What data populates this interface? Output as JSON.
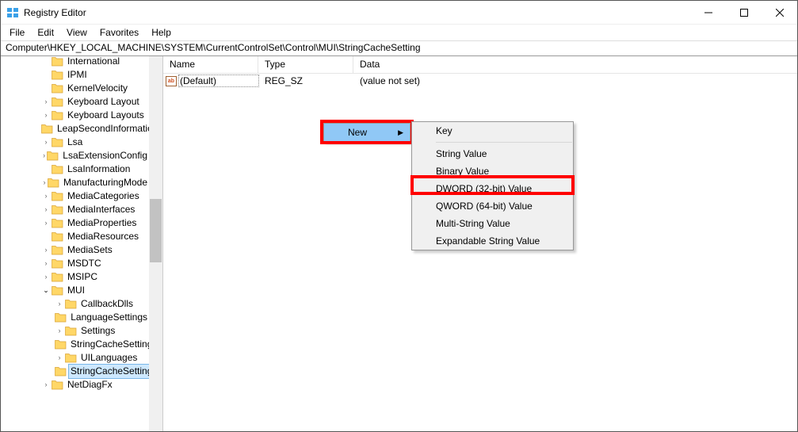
{
  "window": {
    "title": "Registry Editor"
  },
  "menu": {
    "file": "File",
    "edit": "Edit",
    "view": "View",
    "favorites": "Favorites",
    "help": "Help"
  },
  "address": {
    "path": "Computer\\HKEY_LOCAL_MACHINE\\SYSTEM\\CurrentControlSet\\Control\\MUI\\StringCacheSetting"
  },
  "tree": {
    "items": [
      {
        "indent": 3,
        "exp": " ",
        "label": "International"
      },
      {
        "indent": 3,
        "exp": " ",
        "label": "IPMI"
      },
      {
        "indent": 3,
        "exp": " ",
        "label": "KernelVelocity"
      },
      {
        "indent": 3,
        "exp": ">",
        "label": "Keyboard Layout"
      },
      {
        "indent": 3,
        "exp": ">",
        "label": "Keyboard Layouts"
      },
      {
        "indent": 3,
        "exp": " ",
        "label": "LeapSecondInformation"
      },
      {
        "indent": 3,
        "exp": ">",
        "label": "Lsa"
      },
      {
        "indent": 3,
        "exp": ">",
        "label": "LsaExtensionConfig"
      },
      {
        "indent": 3,
        "exp": " ",
        "label": "LsaInformation"
      },
      {
        "indent": 3,
        "exp": ">",
        "label": "ManufacturingMode"
      },
      {
        "indent": 3,
        "exp": ">",
        "label": "MediaCategories"
      },
      {
        "indent": 3,
        "exp": ">",
        "label": "MediaInterfaces"
      },
      {
        "indent": 3,
        "exp": ">",
        "label": "MediaProperties"
      },
      {
        "indent": 3,
        "exp": " ",
        "label": "MediaResources"
      },
      {
        "indent": 3,
        "exp": ">",
        "label": "MediaSets"
      },
      {
        "indent": 3,
        "exp": ">",
        "label": "MSDTC"
      },
      {
        "indent": 3,
        "exp": ">",
        "label": "MSIPC"
      },
      {
        "indent": 3,
        "exp": "v",
        "label": "MUI"
      },
      {
        "indent": 4,
        "exp": ">",
        "label": "CallbackDlls"
      },
      {
        "indent": 4,
        "exp": " ",
        "label": "LanguageSettings"
      },
      {
        "indent": 4,
        "exp": ">",
        "label": "Settings"
      },
      {
        "indent": 4,
        "exp": " ",
        "label": "StringCacheSettings"
      },
      {
        "indent": 4,
        "exp": ">",
        "label": "UILanguages"
      },
      {
        "indent": 4,
        "exp": " ",
        "label": "StringCacheSetting",
        "selected": true
      },
      {
        "indent": 3,
        "exp": ">",
        "label": "NetDiagFx"
      }
    ]
  },
  "list": {
    "headers": {
      "name": "Name",
      "type": "Type",
      "data": "Data"
    },
    "rows": [
      {
        "name": "(Default)",
        "type": "REG_SZ",
        "data": "(value not set)"
      }
    ]
  },
  "context_primary": {
    "new": "New"
  },
  "context_new": {
    "key": "Key",
    "string": "String Value",
    "binary": "Binary Value",
    "dword": "DWORD (32-bit) Value",
    "qword": "QWORD (64-bit) Value",
    "multi": "Multi-String Value",
    "expand": "Expandable String Value"
  }
}
